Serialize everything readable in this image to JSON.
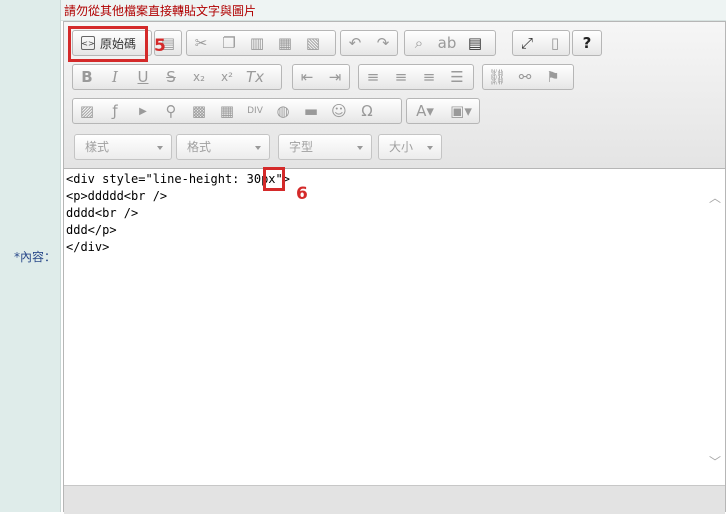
{
  "form": {
    "notice": "請勿從其他檔案直接轉貼文字與圖片",
    "content_label": "*內容："
  },
  "toolbar": {
    "source_label": "原始碼",
    "combos": [
      {
        "label": "樣式"
      },
      {
        "label": "格式"
      },
      {
        "label": "字型"
      },
      {
        "label": "大小"
      }
    ],
    "row1_icons": [
      "templates-icon",
      "cut-icon",
      "copy-icon",
      "paste-icon",
      "paste-text-icon",
      "paste-word-icon",
      "undo-icon",
      "redo-icon",
      "find-icon",
      "replace-icon",
      "select-all-icon",
      "maximize-icon",
      "show-blocks-icon",
      "help-icon"
    ],
    "row2_icons": [
      "bold-icon",
      "italic-icon",
      "underline-icon",
      "strike-icon",
      "subscript-icon",
      "superscript-icon",
      "remove-format-icon",
      "outdent-icon",
      "indent-icon",
      "align-left-icon",
      "align-center-icon",
      "align-right-icon",
      "justify-icon",
      "link-icon",
      "unlink-icon",
      "anchor-icon"
    ],
    "row3_icons": [
      "image-icon",
      "flash-icon",
      "youtube-icon",
      "map-icon",
      "qrcode-icon",
      "table-icon",
      "div-icon",
      "iframe-icon",
      "horizontal-rule-icon",
      "smiley-icon",
      "special-char-icon",
      "text-color-icon",
      "bg-color-icon"
    ]
  },
  "editor": {
    "lines": [
      "<div style=\"line-height: 30px\">",
      "<p>ddddd<br />",
      "dddd<br />",
      "ddd</p>",
      "</div>"
    ]
  },
  "annotations": {
    "step5": "5",
    "step6": "6",
    "accent": "#d42a2a"
  }
}
